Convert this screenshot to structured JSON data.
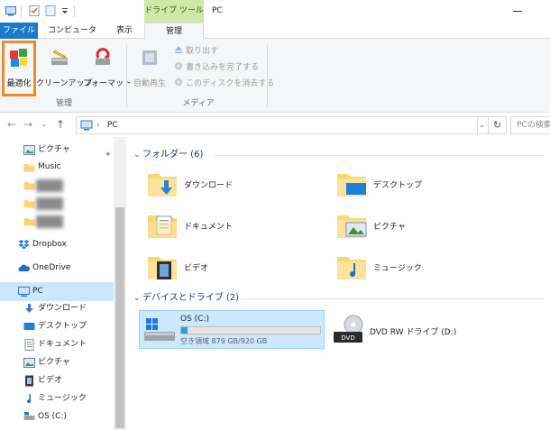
{
  "colors": {
    "accent": "#1979ca",
    "contextual_tab": "#cfe8a7",
    "selection": "#cce8ff",
    "highlight_box": "#f08a24",
    "usage_fill": "#26a0da"
  },
  "title_bar": {
    "contextual_tab_header": "ドライブ ツール",
    "window_title": "PC"
  },
  "ribbon_tabs": {
    "file": "ファイル",
    "computer": "コンピューター",
    "view": "表示",
    "manage": "管理"
  },
  "ribbon": {
    "manage_group": {
      "label": "管理",
      "optimize": "最適化",
      "cleanup": "クリーンアップ",
      "format": "フォーマット"
    },
    "autoplay": "自動再生",
    "media_group": {
      "label": "メディア",
      "eject": "取り出す",
      "finish_burning": "書き込みを完了する",
      "erase_disc": "このディスクを消去する"
    }
  },
  "address_bar": {
    "breadcrumb": "PC",
    "search_placeholder": "PCの検索"
  },
  "nav_pane": {
    "items": [
      {
        "label": "ピクチャ",
        "icon": "pictures-icon"
      },
      {
        "label": "Music",
        "icon": "folder-icon"
      },
      {
        "label": "Dropbox",
        "icon": "dropbox-icon"
      },
      {
        "label": "OneDrive",
        "icon": "onedrive-icon"
      },
      {
        "label": "PC",
        "icon": "pc-icon"
      },
      {
        "label": "ダウンロード",
        "icon": "download-icon"
      },
      {
        "label": "デスクトップ",
        "icon": "desktop-icon"
      },
      {
        "label": "ドキュメント",
        "icon": "documents-icon"
      },
      {
        "label": "ピクチャ",
        "icon": "pictures-icon"
      },
      {
        "label": "ビデオ",
        "icon": "video-icon"
      },
      {
        "label": "ミュージック",
        "icon": "music-icon"
      },
      {
        "label": "OS (C:)",
        "icon": "drive-icon"
      }
    ]
  },
  "content": {
    "folders_header": "フォルダー (6)",
    "folders": [
      {
        "name": "ダウンロード",
        "icon": "download-folder-icon"
      },
      {
        "name": "デスクトップ",
        "icon": "desktop-folder-icon"
      },
      {
        "name": "ドキュメント",
        "icon": "documents-folder-icon"
      },
      {
        "name": "ピクチャ",
        "icon": "pictures-folder-icon"
      },
      {
        "name": "ビデオ",
        "icon": "video-folder-icon"
      },
      {
        "name": "ミュージック",
        "icon": "music-folder-icon"
      }
    ],
    "drives_header": "デバイスとドライブ (2)",
    "drives": [
      {
        "name": "OS (C:)",
        "free_text": "空き領域 879 GB/920 GB",
        "used_fraction": 0.045
      },
      {
        "name": "DVD RW ドライブ (D:)",
        "badge": "DVD"
      }
    ]
  }
}
